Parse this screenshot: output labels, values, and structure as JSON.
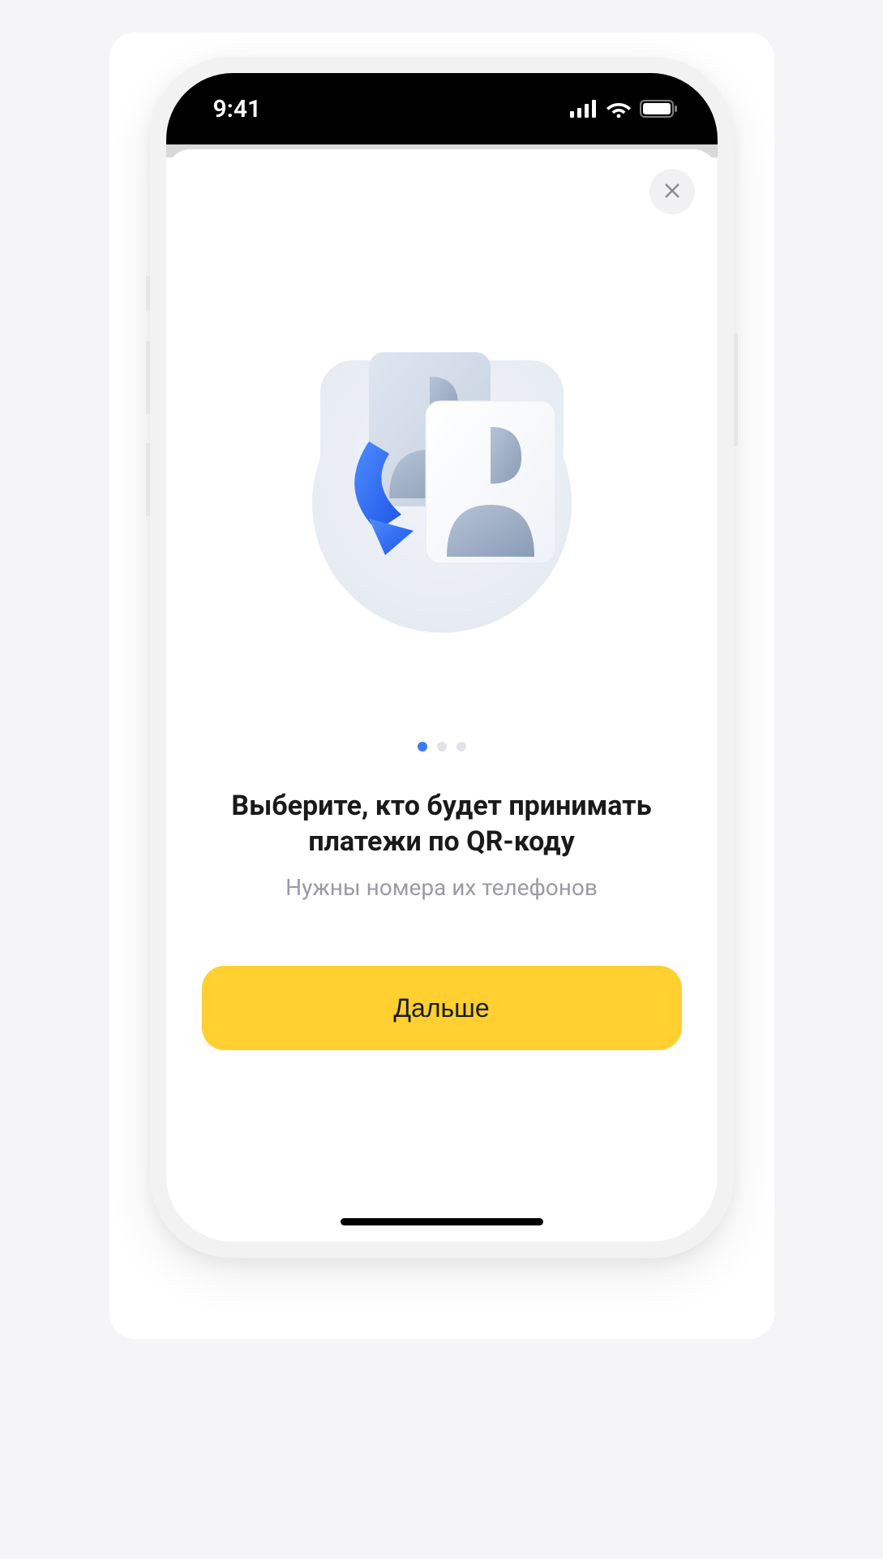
{
  "status": {
    "time": "9:41"
  },
  "onboarding": {
    "page_count": 3,
    "active_page": 0,
    "title": "Выберите, кто будет принимать платежи по QR-коду",
    "subtitle": "Нужны номера их телефонов",
    "next_label": "Дальше"
  },
  "colors": {
    "accent": "#ffd02f",
    "pager_active": "#3a7af2"
  }
}
